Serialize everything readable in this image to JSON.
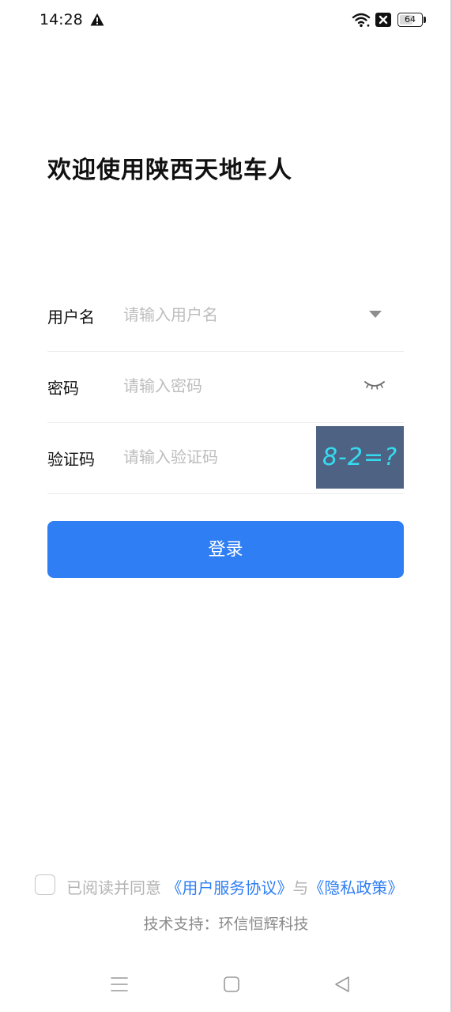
{
  "status_bar": {
    "time": "14:28",
    "battery_level": "64",
    "icons": [
      "warning-icon",
      "wifi-icon",
      "no-sim-icon",
      "battery-icon"
    ]
  },
  "title": "欢迎使用陕西天地车人",
  "form": {
    "username": {
      "label": "用户名",
      "placeholder": "请输入用户名",
      "value": ""
    },
    "password": {
      "label": "密码",
      "placeholder": "请输入密码",
      "value": ""
    },
    "captcha": {
      "label": "验证码",
      "placeholder": "请输入验证码",
      "value": "",
      "image_text": "8-2=?"
    }
  },
  "login_button": {
    "label": "登录"
  },
  "agreement": {
    "prefix": "已阅读并同意",
    "user_agreement": "《用户服务协议》",
    "and": "与",
    "privacy_policy": "《隐私政策》",
    "checked": false
  },
  "tech_support": "技术支持：环信恒辉科技",
  "colors": {
    "primary": "#2f7ef3",
    "captcha_bg": "#4e6283",
    "captcha_text": "#35dcf0",
    "placeholder": "#bdbdbd"
  }
}
